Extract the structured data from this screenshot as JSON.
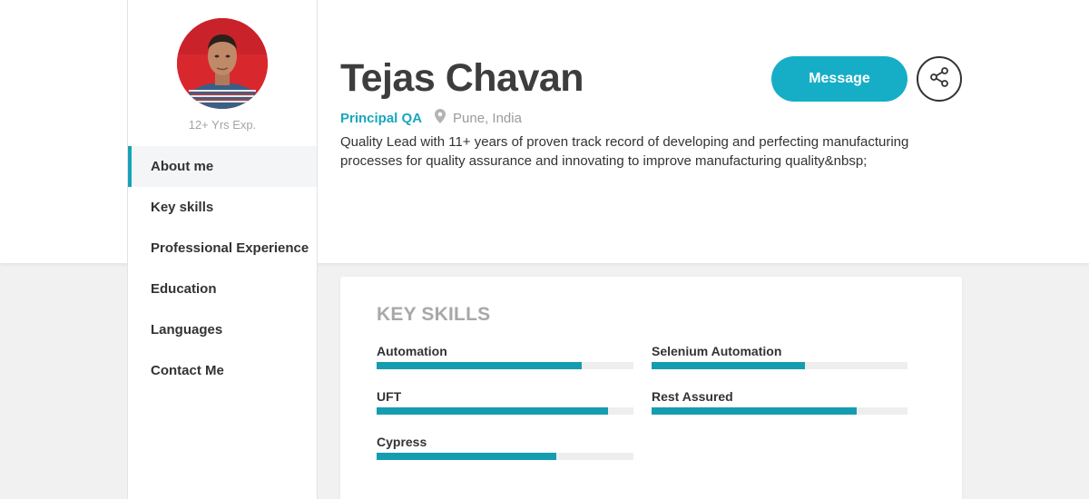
{
  "profile": {
    "experience": "12+ Yrs Exp.",
    "name": "Tejas Chavan",
    "role": "Principal QA",
    "location": "Pune, India",
    "bio": "Quality Lead with 11+ years of proven track record of developing and perfecting manufacturing processes for quality assurance and innovating to improve manufacturing quality&nbsp;"
  },
  "nav": {
    "items": [
      {
        "label": "About me",
        "active": true
      },
      {
        "label": "Key skills"
      },
      {
        "label": "Professional Experience"
      },
      {
        "label": "Education"
      },
      {
        "label": "Languages"
      },
      {
        "label": "Contact Me"
      }
    ]
  },
  "actions": {
    "message_label": "Message",
    "share_icon": "share-icon"
  },
  "skills_section": {
    "title": "KEY SKILLS",
    "skills": [
      {
        "name": "Automation",
        "level": 0.8
      },
      {
        "name": "Selenium Automation",
        "level": 0.6
      },
      {
        "name": "UFT",
        "level": 0.9
      },
      {
        "name": "Rest Assured",
        "level": 0.8
      },
      {
        "name": "Cypress",
        "level": 0.7
      }
    ]
  },
  "colors": {
    "accent": "#16aec7",
    "bar_fill": "#169cb0",
    "bar_track": "#eeeeee"
  }
}
